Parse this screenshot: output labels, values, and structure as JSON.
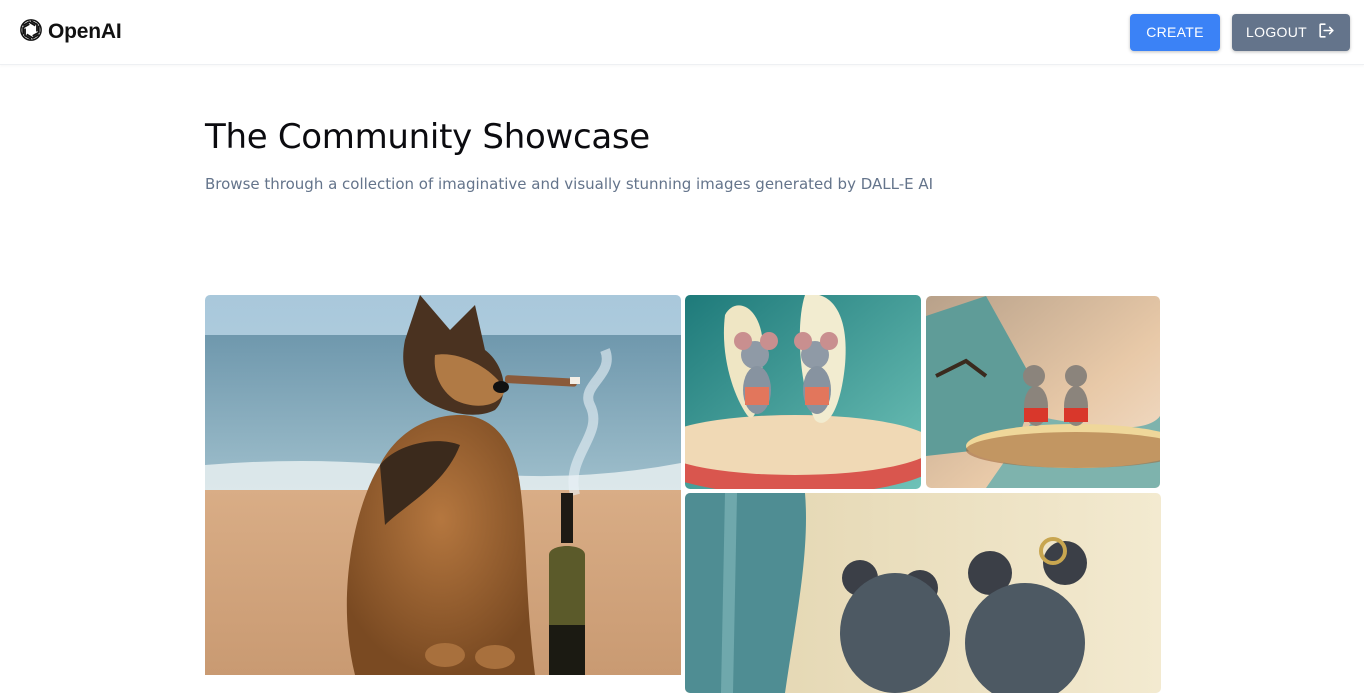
{
  "header": {
    "brand": {
      "name": "OpenAI",
      "icon": "openai-logo-icon"
    },
    "create_label": "CREATE",
    "logout_label": "LOGOUT",
    "logout_icon": "logout-icon",
    "create_color": "#3b82f6",
    "logout_color": "#64748b"
  },
  "main": {
    "title": "The Community Showcase",
    "subtitle": "Browse through a collection of imaginative and visually stunning images generated by DALL-E AI"
  },
  "gallery": {
    "images": [
      {
        "subject": "german-shepherd-dog-smoking-cigar-beach-wine-bottle"
      },
      {
        "subject": "two-mice-holding-surfboards"
      },
      {
        "subject": "two-mice-dancing-on-surfboard"
      },
      {
        "subject": "mice-closeup-near-surfboard"
      }
    ]
  }
}
